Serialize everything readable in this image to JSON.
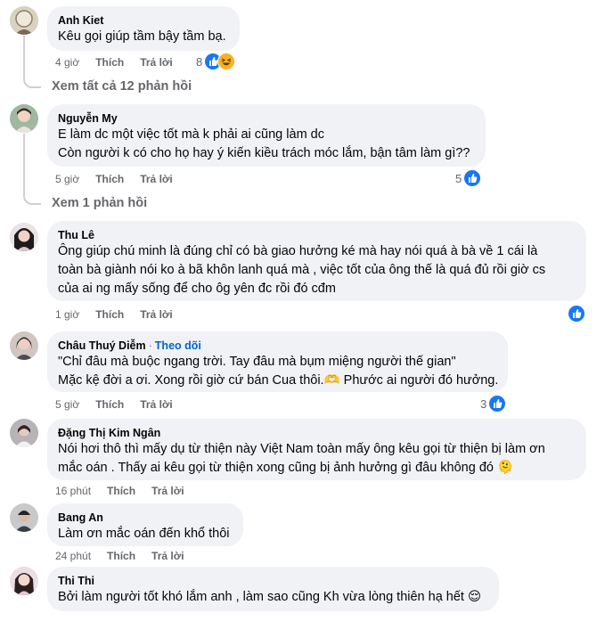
{
  "colors": {
    "bubble": "#f0f2f5",
    "like_blue": "#1877f2",
    "follow_blue": "#0064d1",
    "meta_gray": "#65676b"
  },
  "comments": [
    {
      "author": "Anh Kiet",
      "lines": [
        "Kêu gọi giúp tầm bậy tầm bạ."
      ],
      "time": "4 giờ",
      "like_label": "Thích",
      "reply_label": "Trả lời",
      "reaction_count": "8",
      "reaction_icons": [
        "like-icon",
        "haha-icon"
      ]
    },
    {
      "author": "Nguyễn My",
      "lines": [
        "E làm dc một việc tốt mà k phải ai cũng làm dc",
        "Còn người k có cho họ hay ý kiến kiều trách móc lắm, bận tâm làm gì??"
      ],
      "time": "5 giờ",
      "like_label": "Thích",
      "reply_label": "Trả lời",
      "reaction_count": "5",
      "reaction_icons": [
        "like-icon"
      ]
    },
    {
      "author": "Thu Lê",
      "lines": [
        "Ông giúp chú minh là đúng chỉ có bà giao hưởng ké mà hay nói quá à bà về 1 cái là",
        "toàn bà giành nói ko à bã khôn lanh quá mà , việc tốt của ông thế là quá đủ rồi giờ cs",
        "của ai ng mấy sống để cho ôg yên đc rồi đó cđm"
      ],
      "time": "1 giờ",
      "like_label": "Thích",
      "reply_label": "Trả lời",
      "reaction_count": "",
      "reaction_icons": [
        "like-icon"
      ]
    },
    {
      "author": "Châu Thuý Diễm",
      "follow_label": "Theo dõi",
      "lines": [
        "\"Chỉ đâu mà buộc ngang trời. Tay đâu mà bụm miệng người thế gian\"",
        "Mặc kệ đời a ơi. Xong rồi giờ cứ bán Cua thôi.🫶 Phước ai người đó hưởng."
      ],
      "time": "5 giờ",
      "like_label": "Thích",
      "reply_label": "Trả lời",
      "reaction_count": "3",
      "reaction_icons": [
        "like-icon"
      ]
    },
    {
      "author": "Đặng Thị Kim Ngân",
      "lines": [
        "Nói hơi thô thì mấy dụ từ thiện này Việt Nam toàn mấy ông kêu gọi từ thiện bị làm ơn",
        "mắc oán . Thấy ai kêu gọi từ thiện xong cũng bị ảnh hưởng gì đâu không đó 🫠"
      ],
      "time": "16 phút",
      "like_label": "Thích",
      "reply_label": "Trả lời"
    },
    {
      "author": "Bang An",
      "lines": [
        "Làm ơn mắc oán đến khổ thôi"
      ],
      "time": "24 phút",
      "like_label": "Thích",
      "reply_label": "Trả lời"
    },
    {
      "author": "Thi Thi",
      "lines": [
        "Bởi làm người tốt khó lắm anh , làm sao cũng Kh vừa lòng thiên hạ hết 😌"
      ]
    }
  ],
  "view_replies": [
    "Xem tất cả 12 phản hồi",
    "Xem 1 phản hồi"
  ]
}
